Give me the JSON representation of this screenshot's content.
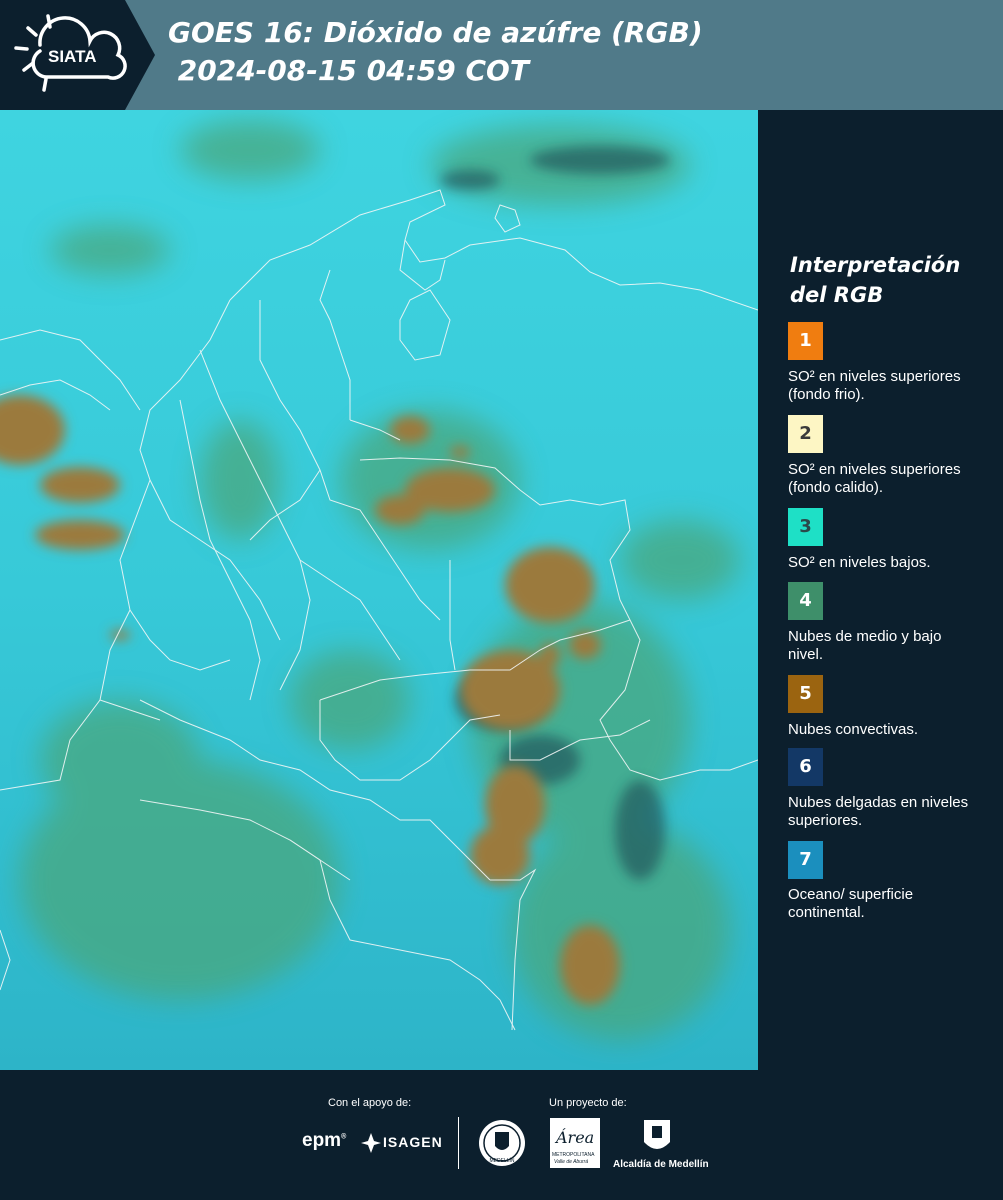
{
  "header": {
    "logo_text": "SIATA",
    "title_line1": "GOES 16: Dióxido de azúfre (RGB)",
    "title_line2": " 2024-08-15 04:59 COT"
  },
  "legend": {
    "title": "Interpretación del RGB",
    "items": [
      {
        "num": "1",
        "color": "#f07d10",
        "text_color": "#ffffff",
        "label": "SO² en niveles superiores (fondo frio)."
      },
      {
        "num": "2",
        "color": "#fdf6c4",
        "text_color": "#3a3a3a",
        "label": "SO² en niveles superiores (fondo calido)."
      },
      {
        "num": "3",
        "color": "#1ee0c6",
        "text_color": "#2a4a4a",
        "label": "SO² en niveles bajos."
      },
      {
        "num": "4",
        "color": "#3e8f6a",
        "text_color": "#ffffff",
        "label": "Nubes de medio y bajo nivel."
      },
      {
        "num": "5",
        "color": "#9b6410",
        "text_color": "#ffffff",
        "label": "Nubes convectivas."
      },
      {
        "num": "6",
        "color": "#133866",
        "text_color": "#ffffff",
        "label": "Nubes delgadas en niveles superiores."
      },
      {
        "num": "7",
        "color": "#1b8fbe",
        "text_color": "#ffffff",
        "label": "Oceano/ superficie continental."
      }
    ]
  },
  "footer": {
    "support_label": "Con el apoyo de:",
    "project_label": "Un proyecto de:",
    "epm_text": "epm",
    "isagen_text": "ISAGEN",
    "area_text": "Área",
    "area_sub1": "METROPOLITANA",
    "area_sub2": "Valle de Aburrá",
    "alcaldia_text": "Alcaldía de Medellín",
    "medellin_seal_text": "MEDELLÍN"
  }
}
